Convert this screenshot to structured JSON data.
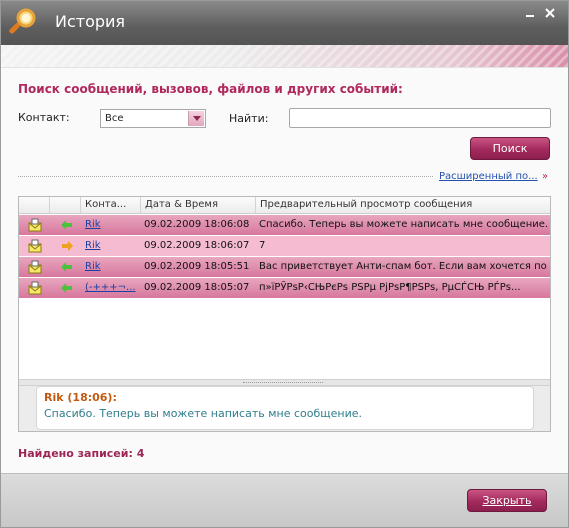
{
  "window": {
    "title": "История"
  },
  "search": {
    "heading": "Поиск сообщений, вызовов, файлов и других событий:",
    "contact_label": "Контакт:",
    "contact_value": "Все",
    "find_label": "Найти:",
    "find_value": "",
    "search_button": "Поиск",
    "advanced_link": "Расширенный по...",
    "advanced_chevron": "»"
  },
  "grid": {
    "columns": [
      "",
      "",
      "Конта...",
      "Дата & Время",
      "Предварительный просмотр сообщения"
    ],
    "sort_column": "Дата & Время",
    "rows": [
      {
        "contact": "Rik",
        "direction": "incoming",
        "datetime": "09.02.2009 18:06:08",
        "preview": "Спасибо. Теперь вы можете написать мне сообщение."
      },
      {
        "contact": "Rik",
        "direction": "outgoing",
        "datetime": "09.02.2009 18:06:07",
        "preview": "7"
      },
      {
        "contact": "Rik",
        "direction": "incoming",
        "datetime": "09.02.2009 18:05:51",
        "preview": "Вас приветствует Анти-спам бот. Если вам хочется пооб"
      },
      {
        "contact": "(-+++¬...",
        "direction": "incoming",
        "datetime": "09.02.2009 18:05:07",
        "preview": "п»їРЎРѕР‹СЊРєРѕ РЅРµ РјРѕР¶РЅРѕ, РµСЃСЊ РЃРѕ..."
      }
    ]
  },
  "preview": {
    "author": "Rik (18:06):",
    "text": "Спасибо. Теперь вы можете написать мне сообщение."
  },
  "status": {
    "found": "Найдено записей: 4"
  },
  "footer": {
    "close_button": "Закрыть"
  },
  "colors": {
    "accent": "#b0295d",
    "row_selected": "#d7779d",
    "row_normal": "#f5bcd1",
    "link": "#1c3fa3"
  }
}
